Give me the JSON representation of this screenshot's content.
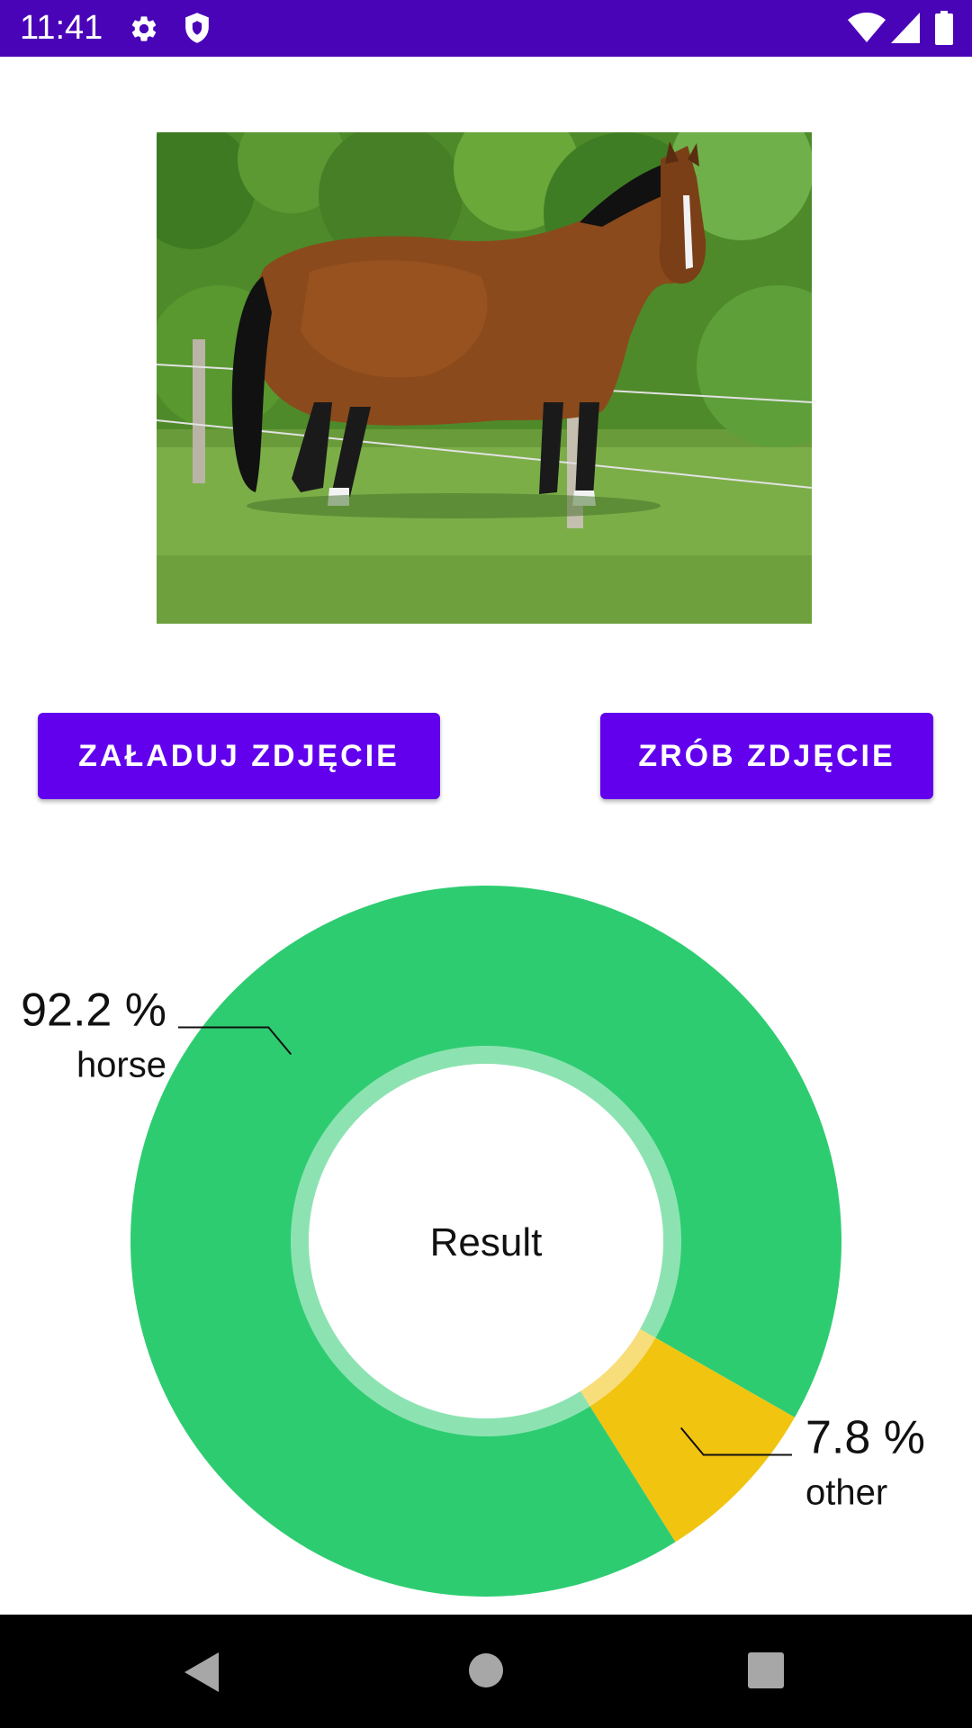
{
  "status_bar": {
    "time": "11:41",
    "background": "#4a04b8",
    "left_icons": [
      "settings-gear-icon",
      "shield-icon"
    ],
    "right_icons": [
      "wifi-icon",
      "cellular-signal-icon",
      "battery-icon"
    ]
  },
  "image": {
    "subject": "horse",
    "description": "Bay horse standing in a grassy pasture in front of a wire fence and green trees"
  },
  "buttons": {
    "load_photo": "ZAŁADUJ ZDJĘCIE",
    "take_photo": "ZRÓB ZDJĘCIE",
    "color": "#6200ee"
  },
  "chart_data": {
    "type": "pie",
    "title": "",
    "center_text": "Result",
    "categories": [
      "horse",
      "other"
    ],
    "values": [
      92.2,
      7.8
    ],
    "value_labels": [
      "92.2 %",
      "7.8 %"
    ],
    "colors": [
      "#2ecc71",
      "#f1c40f"
    ],
    "hole": true
  },
  "nav_bar": {
    "buttons": [
      "back-icon",
      "home-icon",
      "recents-icon"
    ]
  }
}
